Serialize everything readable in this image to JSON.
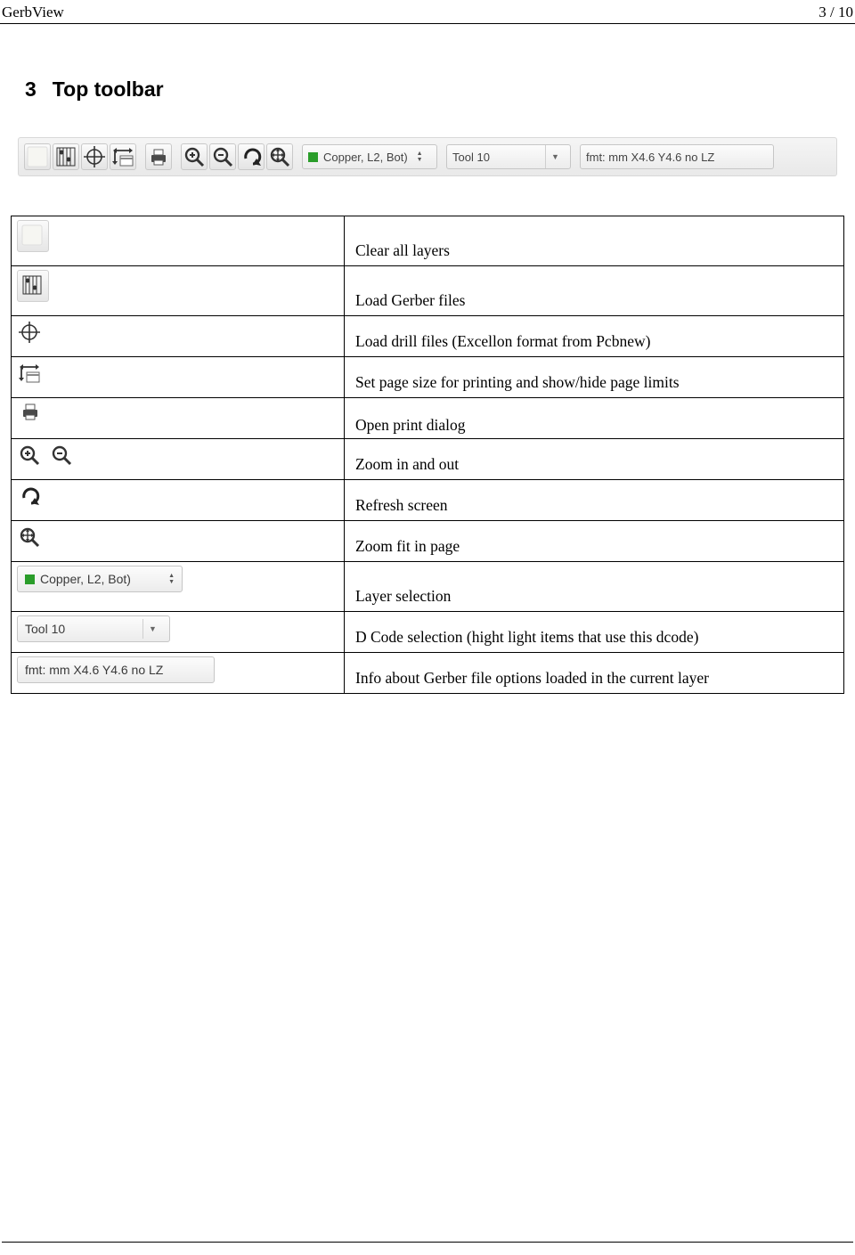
{
  "header": {
    "title": "GerbView",
    "page": "3 / 10"
  },
  "section": {
    "number": "3",
    "title": "Top toolbar"
  },
  "toolbar": {
    "layer_label": "Copper, L2, Bot)",
    "tool_label": "Tool 10",
    "fmt_label": "fmt: mm X4.6 Y4.6 no LZ"
  },
  "rows": [
    {
      "desc": "Clear all layers"
    },
    {
      "desc": "Load Gerber files"
    },
    {
      "desc": "Load drill files (Excellon format from Pcbnew)"
    },
    {
      "desc": "Set page size for printing and show/hide page limits"
    },
    {
      "desc": "Open print dialog"
    },
    {
      "desc": "Zoom in and out"
    },
    {
      "desc": "Refresh screen"
    },
    {
      "desc": "Zoom fit in page"
    },
    {
      "desc": "Layer selection"
    },
    {
      "desc": "D Code selection (hight light items that use this dcode)"
    },
    {
      "desc": "Info about Gerber file options loaded in the current layer"
    }
  ],
  "widgets": {
    "layer_label": "Copper, L2, Bot)",
    "tool_label": "Tool 10",
    "fmt_label": "fmt: mm X4.6 Y4.6 no LZ"
  }
}
